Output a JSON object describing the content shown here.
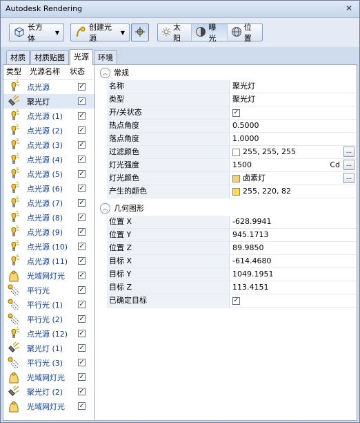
{
  "window": {
    "title": "Autodesk Rendering",
    "close": "✕"
  },
  "toolbar": {
    "shape_label": "长方体",
    "create_light_label": "创建光源",
    "sun_label": "太阳",
    "exposure_label": "曝光",
    "location_label": "位置"
  },
  "tabs": [
    "材质",
    "材质贴图",
    "光源",
    "环境"
  ],
  "list": {
    "headers": {
      "type": "类型",
      "name": "光源名称",
      "status": "状态"
    },
    "items": [
      {
        "name": "点光源",
        "icon": "point-light-icon"
      },
      {
        "name": "聚光灯",
        "icon": "spot-light-icon",
        "selected": true
      },
      {
        "name": "点光源 (1)",
        "icon": "point-light-icon"
      },
      {
        "name": "点光源 (2)",
        "icon": "point-light-icon"
      },
      {
        "name": "点光源 (3)",
        "icon": "point-light-icon"
      },
      {
        "name": "点光源 (4)",
        "icon": "point-light-icon"
      },
      {
        "name": "点光源 (5)",
        "icon": "point-light-icon"
      },
      {
        "name": "点光源 (6)",
        "icon": "point-light-icon"
      },
      {
        "name": "点光源 (7)",
        "icon": "point-light-icon"
      },
      {
        "name": "点光源 (8)",
        "icon": "point-light-icon"
      },
      {
        "name": "点光源 (9)",
        "icon": "point-light-icon"
      },
      {
        "name": "点光源 (10)",
        "icon": "point-light-icon"
      },
      {
        "name": "点光源 (11)",
        "icon": "point-light-icon"
      },
      {
        "name": "光域网灯光",
        "icon": "web-light-icon"
      },
      {
        "name": "平行光",
        "icon": "distant-light-icon"
      },
      {
        "name": "平行光 (1)",
        "icon": "distant-light-icon"
      },
      {
        "name": "平行光 (2)",
        "icon": "distant-light-icon"
      },
      {
        "name": "点光源 (12)",
        "icon": "point-light-icon"
      },
      {
        "name": "聚光灯 (1)",
        "icon": "spot-light-icon"
      },
      {
        "name": "平行光 (3)",
        "icon": "distant-light-icon"
      },
      {
        "name": "光域网灯光",
        "icon": "web-light-icon"
      },
      {
        "name": "聚光灯 (2)",
        "icon": "spot-light-icon"
      },
      {
        "name": "光域网灯光",
        "icon": "web-light-icon"
      }
    ]
  },
  "general": {
    "title": "常规",
    "name_k": "名称",
    "name_v": "聚光灯",
    "type_k": "类型",
    "type_v": "聚光灯",
    "onoff_k": "开/关状态",
    "hotspot_k": "热点角度",
    "hotspot_v": "0.5000",
    "falloff_k": "落点角度",
    "falloff_v": "1.0000",
    "filter_k": "过滤颜色",
    "filter_v": "255, 255, 255",
    "filter_color": "#ffffff",
    "intensity_k": "灯光强度",
    "intensity_v": "1500",
    "intensity_unit": "Cd",
    "lampcolor_k": "灯光颜色",
    "lampcolor_v": "卤素灯",
    "lamp_color": "#f5d27a",
    "result_k": "产生的颜色",
    "result_v": "255, 220, 82",
    "result_color": "#ffdc52"
  },
  "geometry": {
    "title": "几何图形",
    "px_k": "位置 X",
    "px_v": "-628.9941",
    "py_k": "位置 Y",
    "py_v": "945.1713",
    "pz_k": "位置 Z",
    "pz_v": "89.9850",
    "tx_k": "目标 X",
    "tx_v": "-614.4680",
    "ty_k": "目标 Y",
    "ty_v": "1049.1951",
    "tz_k": "目标 Z",
    "tz_v": "113.4151",
    "targeted_k": "已确定目标"
  },
  "check_mark": "✓",
  "ellipsis": "..."
}
